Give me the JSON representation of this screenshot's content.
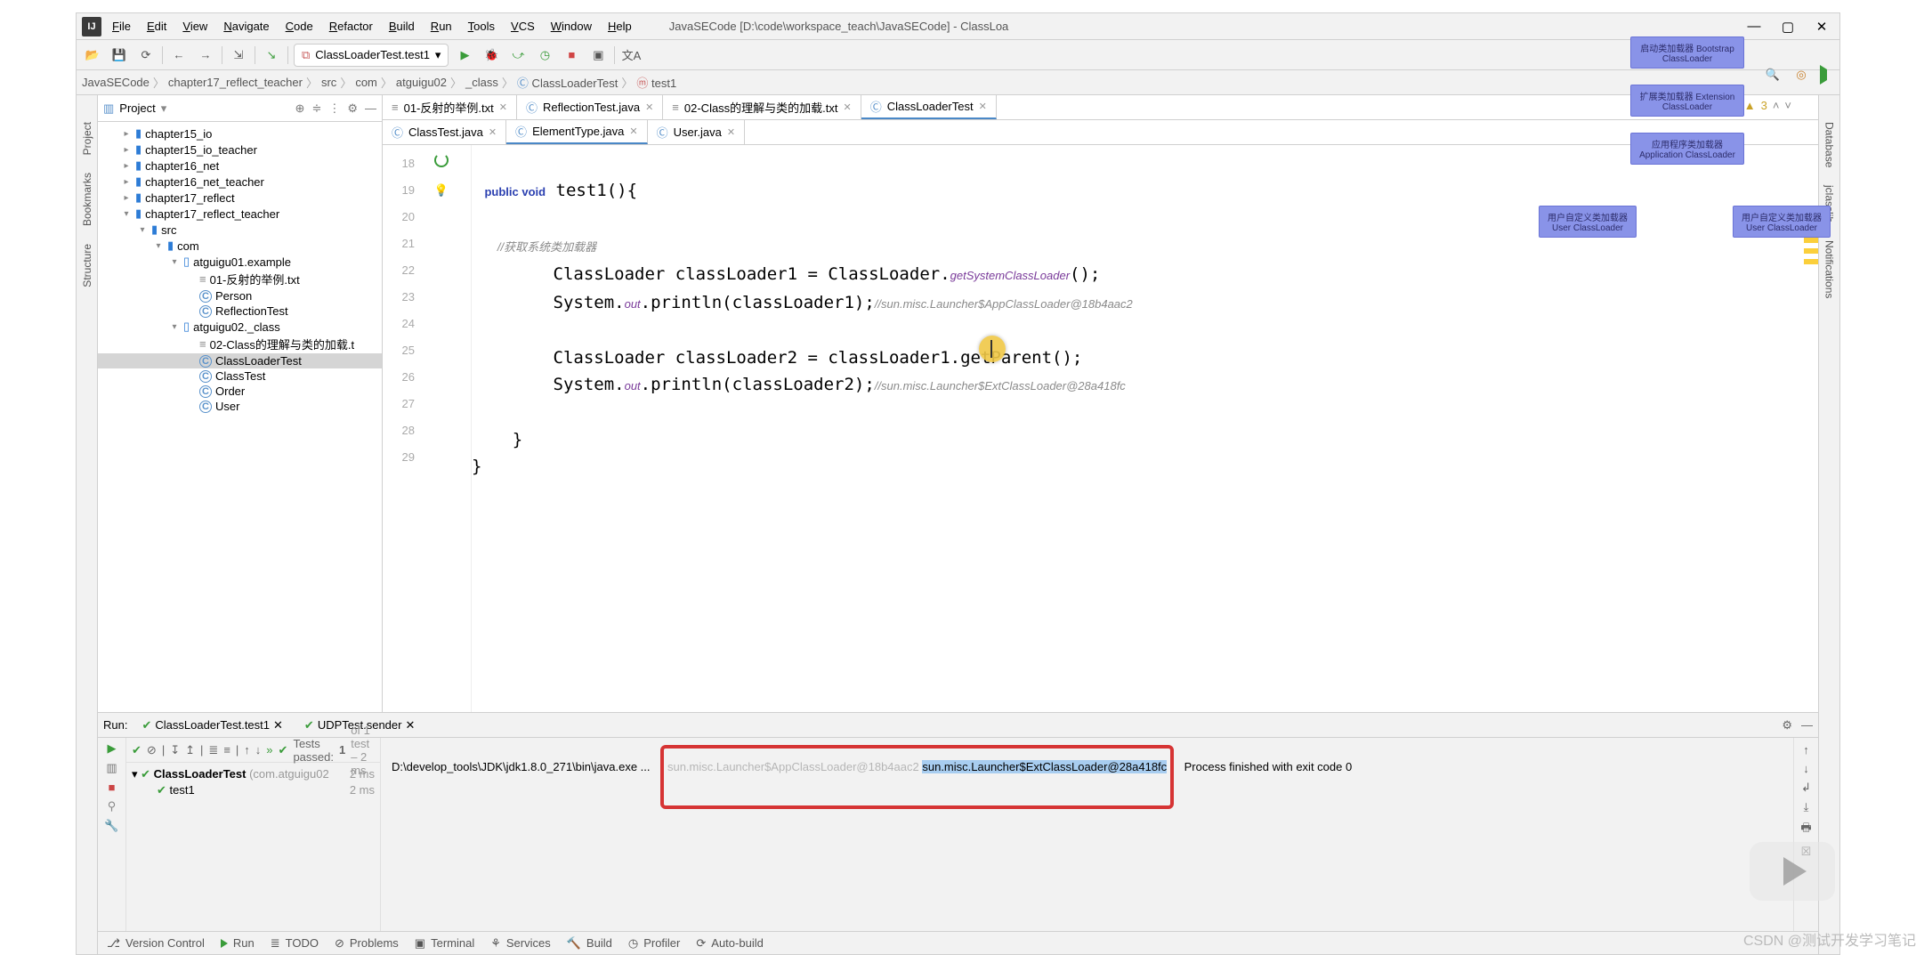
{
  "title_path": "JavaSECode [D:\\code\\workspace_teach\\JavaSECode] - ClassLoa",
  "menu": [
    "File",
    "Edit",
    "View",
    "Navigate",
    "Code",
    "Refactor",
    "Build",
    "Run",
    "Tools",
    "VCS",
    "Window",
    "Help"
  ],
  "run_config": "ClassLoaderTest.test1",
  "breadcrumbs": [
    "JavaSECode",
    "chapter17_reflect_teacher",
    "src",
    "com",
    "atguigu02",
    "_class",
    "ClassLoaderTest",
    "test1"
  ],
  "project_label": "Project",
  "tree": [
    {
      "ind": 1,
      "caret": "▸",
      "kind": "dir",
      "label": "chapter15_io"
    },
    {
      "ind": 1,
      "caret": "▸",
      "kind": "dir",
      "label": "chapter15_io_teacher"
    },
    {
      "ind": 1,
      "caret": "▸",
      "kind": "dir",
      "label": "chapter16_net"
    },
    {
      "ind": 1,
      "caret": "▸",
      "kind": "dir",
      "label": "chapter16_net_teacher"
    },
    {
      "ind": 1,
      "caret": "▸",
      "kind": "dir",
      "label": "chapter17_reflect"
    },
    {
      "ind": 1,
      "caret": "▾",
      "kind": "dir",
      "label": "chapter17_reflect_teacher"
    },
    {
      "ind": 2,
      "caret": "▾",
      "kind": "dir",
      "label": "src"
    },
    {
      "ind": 3,
      "caret": "▾",
      "kind": "dir",
      "label": "com"
    },
    {
      "ind": 4,
      "caret": "▾",
      "kind": "pkg",
      "label": "atguigu01.example"
    },
    {
      "ind": 5,
      "caret": "",
      "kind": "txt",
      "label": "01-反射的举例.txt"
    },
    {
      "ind": 5,
      "caret": "",
      "kind": "cls",
      "label": "Person"
    },
    {
      "ind": 5,
      "caret": "",
      "kind": "cls",
      "label": "ReflectionTest"
    },
    {
      "ind": 4,
      "caret": "▾",
      "kind": "pkg",
      "label": "atguigu02._class"
    },
    {
      "ind": 5,
      "caret": "",
      "kind": "txt",
      "label": "02-Class的理解与类的加载.t"
    },
    {
      "ind": 5,
      "caret": "",
      "kind": "cls",
      "label": "ClassLoaderTest",
      "sel": true
    },
    {
      "ind": 5,
      "caret": "",
      "kind": "cls",
      "label": "ClassTest"
    },
    {
      "ind": 5,
      "caret": "",
      "kind": "cls",
      "label": "Order"
    },
    {
      "ind": 5,
      "caret": "",
      "kind": "cls",
      "label": "User"
    }
  ],
  "tabs_row1": [
    {
      "icon": "txt",
      "label": "01-反射的举例.txt"
    },
    {
      "icon": "cls",
      "label": "ReflectionTest.java"
    },
    {
      "icon": "txt",
      "label": "02-Class的理解与类的加载.txt"
    },
    {
      "icon": "cls",
      "label": "ClassLoaderTest",
      "active": true
    }
  ],
  "tabs_row2": [
    {
      "icon": "cls",
      "label": "ClassTest.java"
    },
    {
      "icon": "cls",
      "label": "ElementType.java",
      "active": true
    },
    {
      "icon": "cls",
      "label": "User.java"
    }
  ],
  "line_start": 18,
  "line_end": 29,
  "code_line18": "    public void test1(){",
  "code_line20": "        //获取系统类加载器",
  "code_line21": "        ClassLoader classLoader1 = ClassLoader.getSystemClassLoader();",
  "code_line22a": "        System.out.println(classLoader1);",
  "code_line22b": "//sun.misc.Launcher$AppClassLoader@18b4aac2",
  "code_line24": "        ClassLoader classLoader2 = classLoader1.getParent();",
  "code_line25a": "        System.out.println(classLoader2);",
  "code_line25b": "//sun.misc.Launcher$ExtClassLoader@28a418fc",
  "code_line27": "    }",
  "code_line28": "}",
  "warn_count": "3",
  "run": {
    "label_run": "Run:",
    "tabs": [
      {
        "label": "ClassLoaderTest.test1",
        "icon": "ok"
      },
      {
        "label": "UDPTest.sender",
        "icon": "ok"
      }
    ],
    "tests_passed_pre": "Tests passed:",
    "tests_passed_num": "1",
    "tests_passed_post": "of 1 test – 2 ms",
    "tree_root_label": "ClassLoaderTest",
    "tree_root_pkg": "(com.atguigu02",
    "tree_root_time": "2 ms",
    "tree_child_label": "test1",
    "tree_child_time": "2 ms",
    "console_line1": "D:\\develop_tools\\JDK\\jdk1.8.0_271\\bin\\java.exe ...",
    "console_line2": "sun.misc.Launcher$AppClassLoader@18b4aac2",
    "console_line3": "sun.misc.Launcher$ExtClassLoader@28a418fc",
    "console_line4": "Process finished with exit code 0"
  },
  "status_items": [
    "Version Control",
    "Run",
    "TODO",
    "Problems",
    "Terminal",
    "Services",
    "Build",
    "Profiler",
    "Auto-build"
  ],
  "status_active": "Run",
  "diagram": {
    "b1": "启动类加载器\nBootstrap ClassLoader",
    "b2": "扩展类加载器\nExtension ClassLoader",
    "b3": "应用程序类加载器\nApplication ClassLoader",
    "b4": "用户自定义类加载器\nUser ClassLoader",
    "b5": "用户自定义类加载器\nUser ClassLoader"
  },
  "watermark": "CSDN @测试开发学习笔记",
  "side_left": [
    "Project",
    "Bookmarks",
    "Structure"
  ],
  "side_right": [
    "Database",
    "jclasslib",
    "Notifications"
  ]
}
